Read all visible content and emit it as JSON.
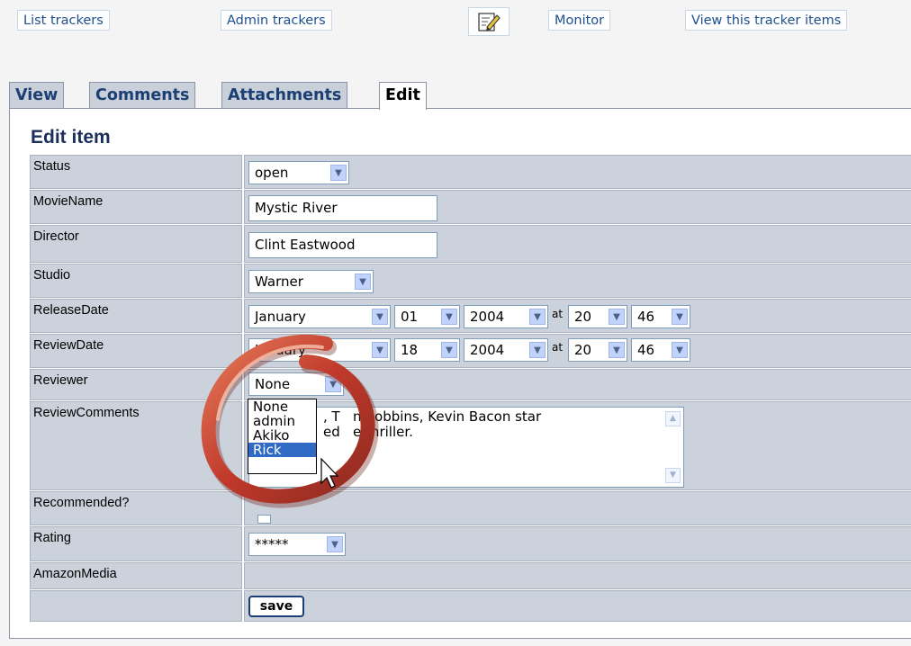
{
  "toplinks": {
    "list_trackers": "List trackers",
    "admin_trackers": "Admin trackers",
    "monitor": "Monitor",
    "view_items": "View this tracker items"
  },
  "tabs": {
    "view": "View",
    "comments": "Comments",
    "attachments": "Attachments",
    "edit": "Edit"
  },
  "form": {
    "title": "Edit item",
    "labels": {
      "status": "Status",
      "movie_name": "MovieName",
      "director": "Director",
      "studio": "Studio",
      "release_date": "ReleaseDate",
      "review_date": "ReviewDate",
      "reviewer": "Reviewer",
      "review_comments": "ReviewComments",
      "recommended": "Recommended?",
      "rating": "Rating",
      "amazon_media": "AmazonMedia"
    },
    "values": {
      "status": "open",
      "movie_name": "Mystic River",
      "director": "Clint Eastwood",
      "studio": "Warner",
      "release_month": "January",
      "release_day": "01",
      "release_year": "2004",
      "release_hour": "20",
      "release_minute": "46",
      "review_month": "January",
      "review_day": "18",
      "review_year": "2004",
      "review_hour": "20",
      "review_minute": "46",
      "reviewer": "None",
      "review_comments_line1": ", T   n Robbins, Kevin Bacon star",
      "review_comments_line2": "ed   e thriller.",
      "rating": "*****"
    },
    "at_label": "at",
    "save_label": "save"
  },
  "reviewer_dropdown": {
    "options": [
      "None",
      "admin",
      "Akiko",
      "Rick"
    ],
    "highlighted": "Rick"
  },
  "colors": {
    "accent": "#316ac5",
    "label_bg": "#cbd2db",
    "ring": "#c0392b"
  }
}
